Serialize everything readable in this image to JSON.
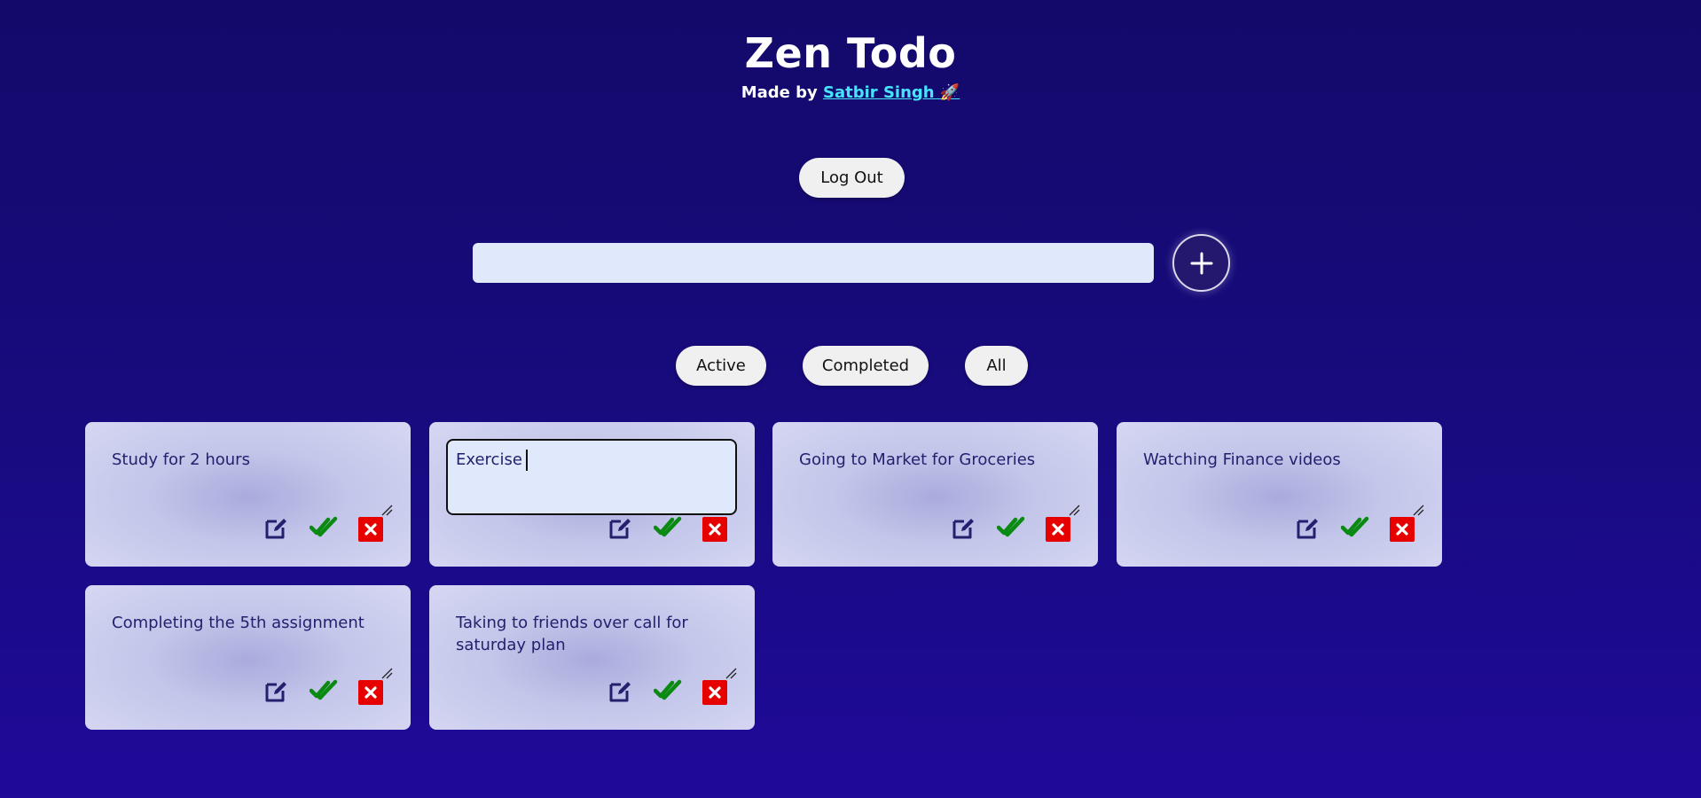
{
  "header": {
    "title": "Zen Todo",
    "made_by": "Made by",
    "author": "Satbir Singh 🚀"
  },
  "logout_label": "Log Out",
  "new_todo": {
    "value": "",
    "add_icon": "plus-icon"
  },
  "filters": {
    "active": "Active",
    "completed": "Completed",
    "all": "All"
  },
  "todos": [
    {
      "text": "Study for 2 hours"
    },
    {
      "text": "Exercise",
      "editing": true
    },
    {
      "text": "Going to Market for Groceries"
    },
    {
      "text": "Watching Finance videos"
    },
    {
      "text": "Completing the 5th assignment"
    },
    {
      "text": "Taking to friends over call for saturday plan"
    }
  ],
  "icons": {
    "edit": "edit-icon",
    "complete": "double-check-icon",
    "delete": "close-icon"
  },
  "colors": {
    "link": "#48e4ff",
    "check": "#0a8a12",
    "delete": "#e60000",
    "edit": "#24206e"
  }
}
